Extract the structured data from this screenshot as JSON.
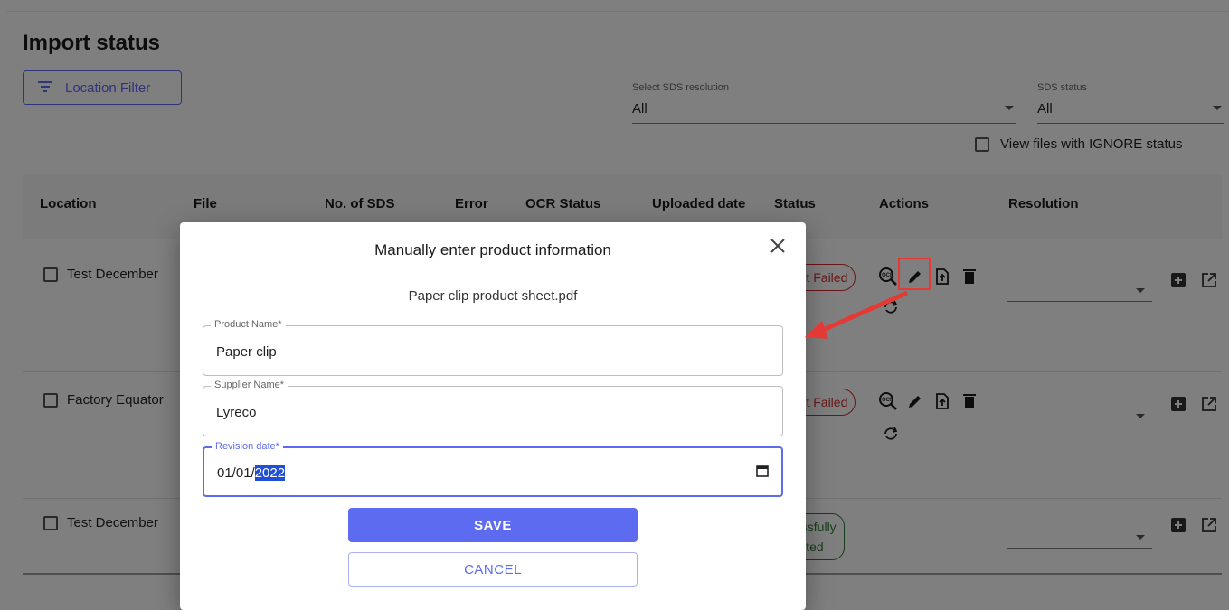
{
  "page": {
    "title": "Import status",
    "location_filter_label": "Location Filter",
    "sds_resolution": {
      "label": "Select SDS resolution",
      "value": "All"
    },
    "sds_status": {
      "label": "SDS status",
      "value": "All"
    },
    "ignore_checkbox_label": "View files with IGNORE status"
  },
  "table": {
    "headers": [
      "Location",
      "File",
      "No. of SDS",
      "Error",
      "OCR Status",
      "Uploaded date",
      "Status",
      "Actions",
      "Resolution"
    ],
    "rows": [
      {
        "location": "Test December",
        "status": "ort Failed",
        "status_type": "failed"
      },
      {
        "location": "Factory Equator",
        "status": "ort Failed",
        "status_type": "failed"
      },
      {
        "location": "Test December",
        "status_line1": "cessfully",
        "status_line2": "ported",
        "status_type": "success"
      }
    ]
  },
  "dialog": {
    "title": "Manually enter product information",
    "file_name": "Paper clip product sheet.pdf",
    "product_name": {
      "label": "Product Name*",
      "value": "Paper clip"
    },
    "supplier_name": {
      "label": "Supplier Name*",
      "value": "Lyreco"
    },
    "revision_date": {
      "label": "Revision date*",
      "value_prefix": "01/01/",
      "value_selected": "2022"
    },
    "save_label": "SAVE",
    "cancel_label": "CANCEL"
  },
  "colors": {
    "accent": "#5c6bf0",
    "error": "#d32f2f",
    "success": "#2e7d32",
    "annotation": "#e53935"
  },
  "icons": [
    "filter-icon",
    "ocr-icon",
    "edit-icon",
    "upload-file-icon",
    "delete-icon",
    "sync-icon",
    "add-box-icon",
    "open-in-new-icon",
    "close-icon",
    "calendar-icon"
  ]
}
